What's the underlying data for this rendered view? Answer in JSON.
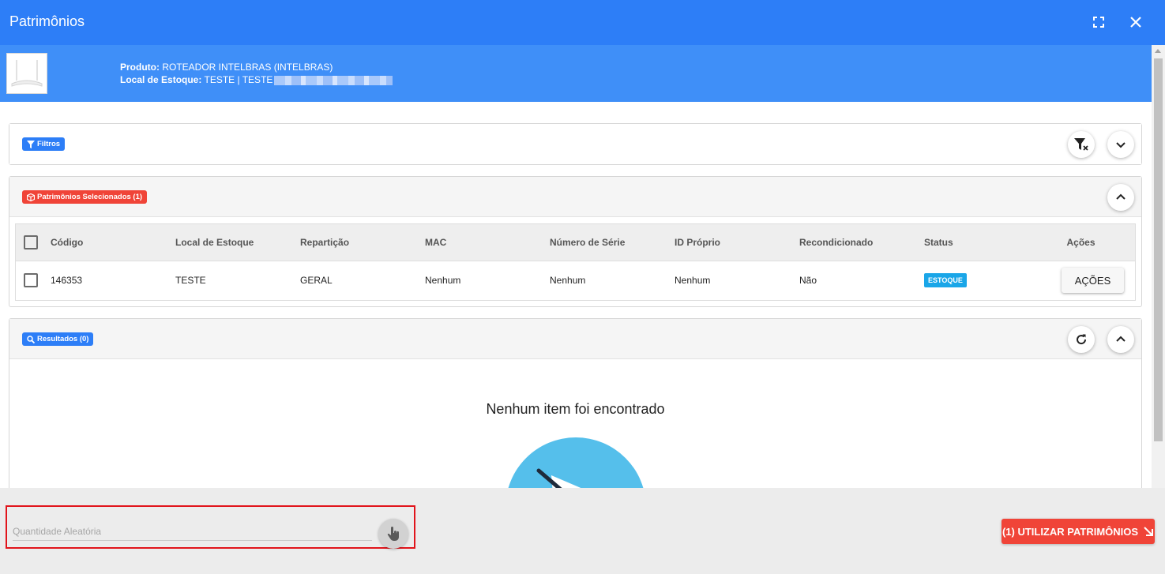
{
  "window": {
    "title": "Patrimônios",
    "icons": [
      "fullscreen-icon",
      "close-icon"
    ]
  },
  "product": {
    "produto_label": "Produto:",
    "produto_value": "ROTEADOR INTELBRAS (INTELBRAS)",
    "local_label": "Local de Estoque:",
    "local_value": "TESTE | TESTE"
  },
  "filters": {
    "tag_label": "Filtros",
    "icons": [
      "filter-icon",
      "clear-filter-icon",
      "chevron-down-icon"
    ]
  },
  "selected": {
    "tag_label": "Patrimônios Selecionados (1)",
    "columns": [
      "Código",
      "Local de Estoque",
      "Repartição",
      "MAC",
      "Número de Série",
      "ID Próprio",
      "Recondicionado",
      "Status",
      "Ações"
    ],
    "rows": [
      {
        "codigo": "146353",
        "local": "TESTE",
        "reparticao": "GERAL",
        "mac": "Nenhum",
        "numero_serie": "Nenhum",
        "id_proprio": "Nenhum",
        "recondicionado": "Não",
        "status": "ESTOQUE",
        "acoes_label": "AÇÕES"
      }
    ]
  },
  "results": {
    "tag_label": "Resultados (0)",
    "empty_text": "Nenhum item foi encontrado",
    "icons": [
      "search-icon",
      "refresh-icon",
      "chevron-up-icon"
    ]
  },
  "footer": {
    "random_placeholder": "Quantidade Aleatória",
    "utilizar_label": "(1) UTILIZAR PATRIMÔNIOS"
  },
  "colors": {
    "primary": "#2d7ef7",
    "header_light": "#3f8ff8",
    "danger": "#f04438",
    "status_badge": "#1aa6e8",
    "highlight_border": "#e1141b"
  }
}
